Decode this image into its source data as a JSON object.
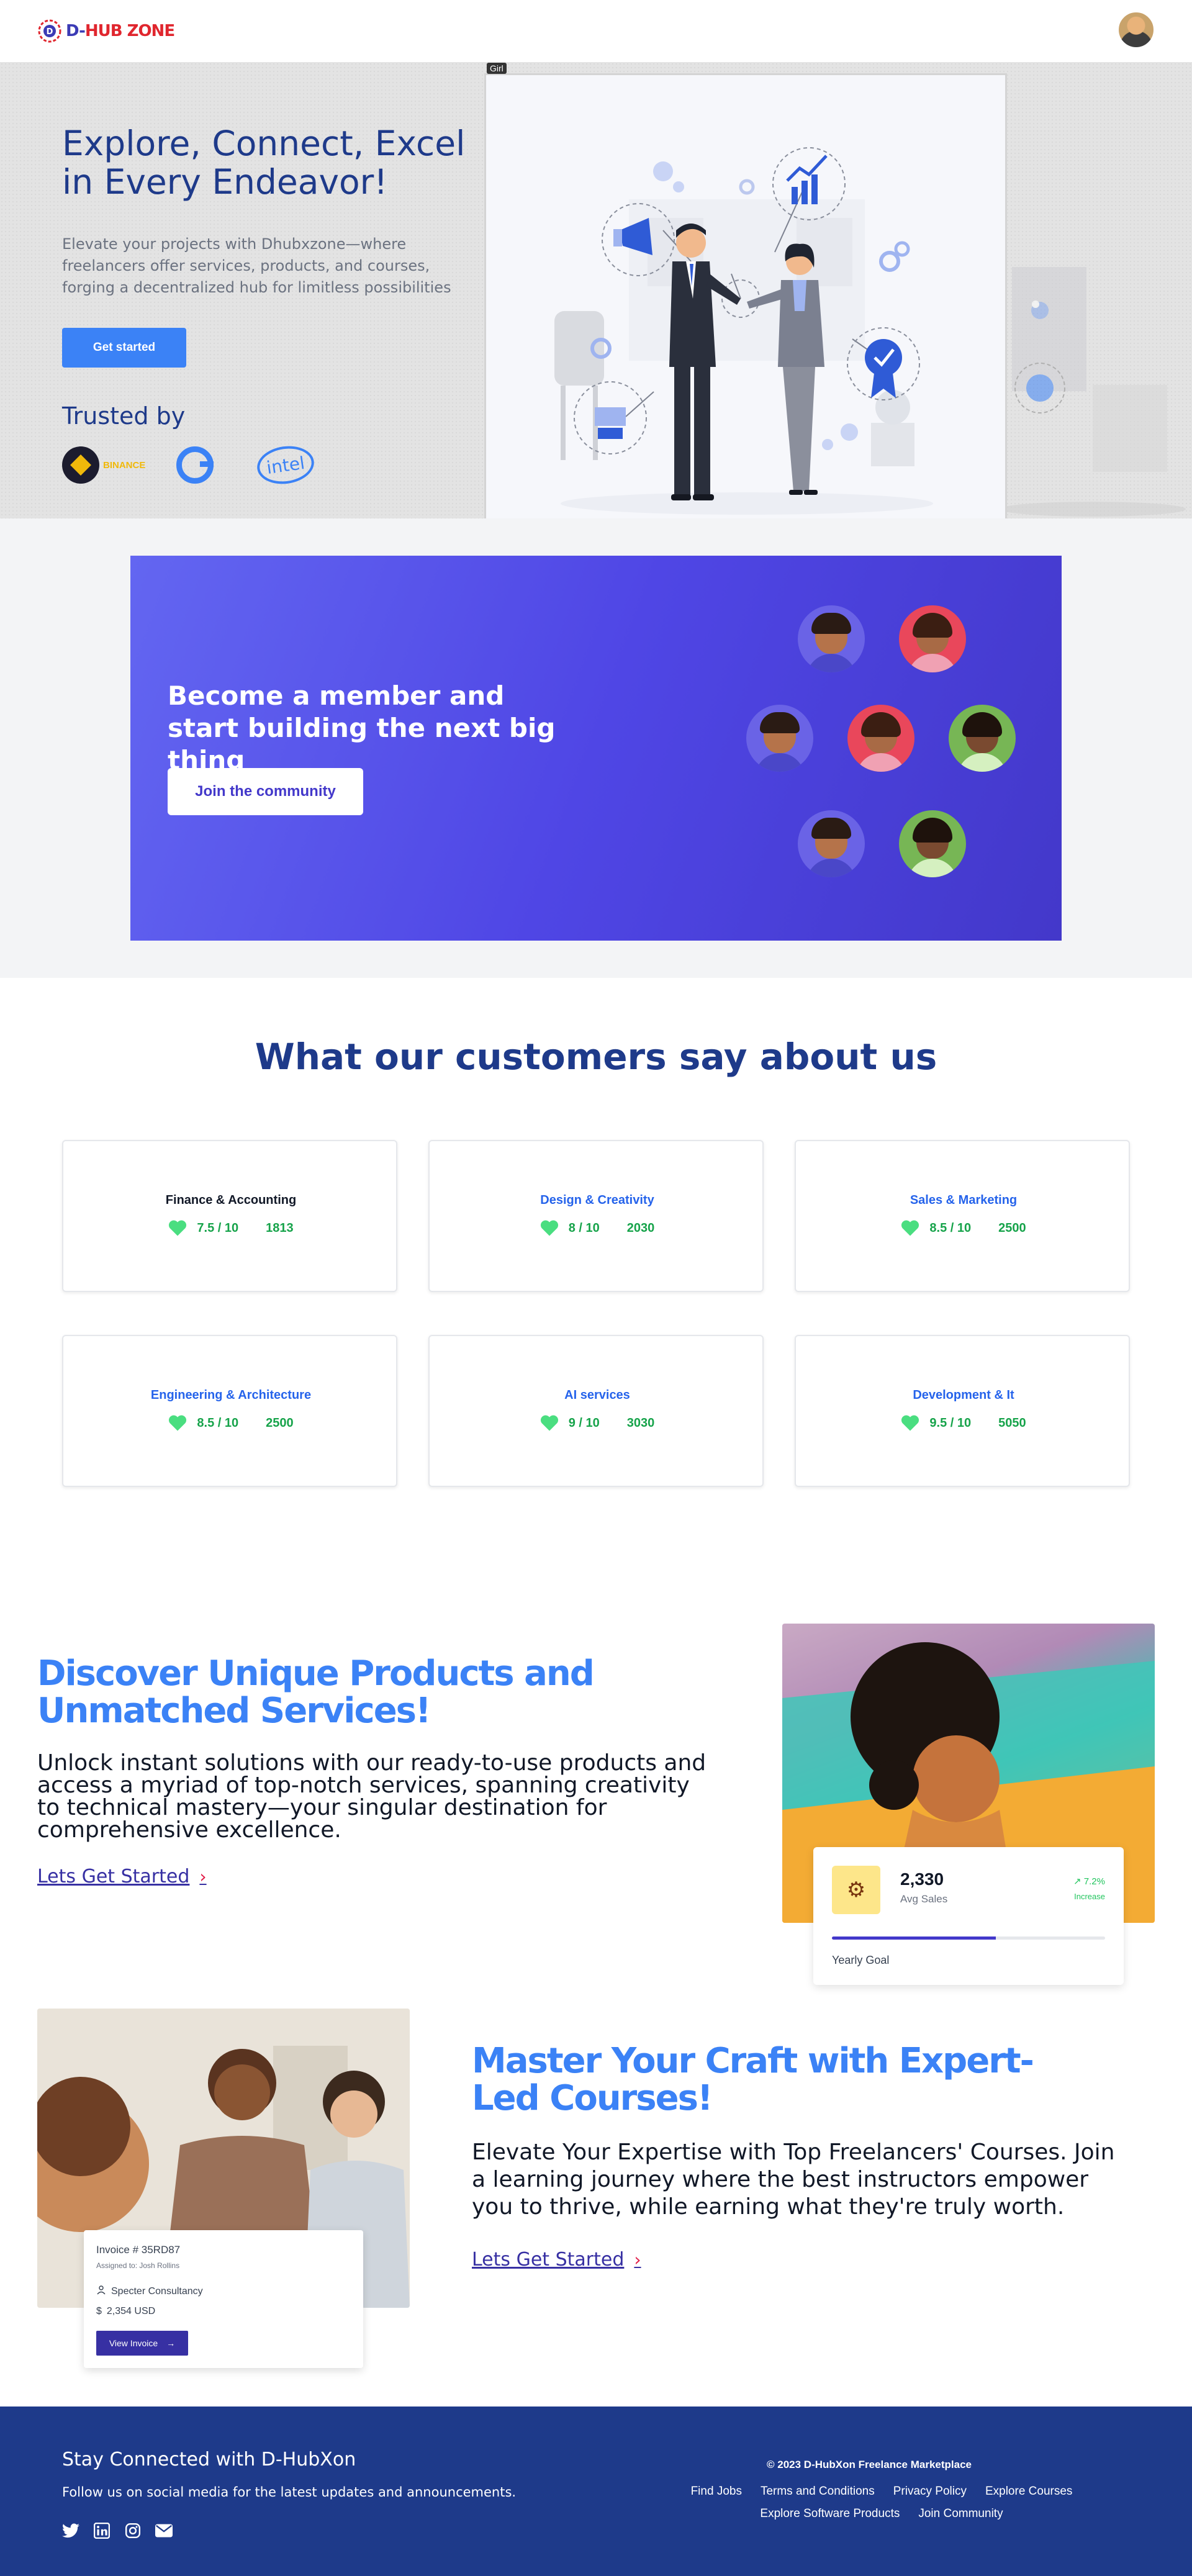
{
  "nav": {
    "logo_text_d": "D-",
    "logo_text_rest": "HUB ZONE",
    "logo_alt": "Logo"
  },
  "hero": {
    "title": "Explore, Connect, Excel in Every Endeavor!",
    "subtitle": "Elevate your projects with Dhubxzone—where freelancers offer services, products, and courses, forging a decentralized hub for limitless possibilities",
    "cta_label": "Get started",
    "trusted_label": "Trusted by",
    "brands": [
      "BINANCE",
      "intel"
    ],
    "illustration_tag": "Girl",
    "brand_color": "#1e3a8a",
    "accent_color": "#3b82f6"
  },
  "member_banner": {
    "title": "Become a member and start building the next big thing",
    "cta_label": "Join the community",
    "gradient": [
      "#6366f1",
      "#4338ca"
    ]
  },
  "reviews": {
    "title": "What our customers say about us",
    "cards": [
      {
        "category": "Finance & Accounting",
        "rating": "7.5 / 10",
        "count": "1813",
        "title_color": "#111827"
      },
      {
        "category": "Design & Creativity",
        "rating": "8 / 10",
        "count": "2030",
        "title_color": "#2563eb"
      },
      {
        "category": "Sales & Marketing",
        "rating": "8.5 / 10",
        "count": "2500",
        "title_color": "#2563eb"
      },
      {
        "category": "Engineering & Architecture",
        "rating": "8.5 / 10",
        "count": "2500",
        "title_color": "#2563eb"
      },
      {
        "category": "AI services",
        "rating": "9 / 10",
        "count": "3030",
        "title_color": "#2563eb"
      },
      {
        "category": "Development & It",
        "rating": "9.5 / 10",
        "count": "5050",
        "title_color": "#2563eb"
      }
    ]
  },
  "discover": {
    "title": "Discover Unique Products and Unmatched Services!",
    "text": "Unlock instant solutions with our ready-to-use products and access a myriad of top-notch services, spanning creativity to technical mastery—your singular destination for comprehensive excellence.",
    "cta_label": "Lets Get Started",
    "stat": {
      "value": "2,330",
      "label": "Avg Sales",
      "percent": "7.2%",
      "trend": "Increase",
      "goal_label": "Yearly Goal",
      "goal_progress": 0.6
    }
  },
  "master": {
    "title": "Master Your Craft with Expert-Led Courses!",
    "text": "Elevate Your Expertise with Top Freelancers' Courses. Join a learning journey where the best instructors empower you to thrive, while earning what they're truly worth.",
    "cta_label": "Lets Get Started",
    "invoice": {
      "number": "Invoice # 35RD87",
      "assigned": "Assigned to: Josh Rollins",
      "company": "Specter Consultancy",
      "amount": "2,354 USD",
      "button": "View Invoice"
    }
  },
  "footer": {
    "title": "Stay Connected with D-HubXon",
    "subtitle": "Follow us on social media for the latest updates and announcements.",
    "copyright": "© 2023 D-HubXon Freelance Marketplace",
    "links": [
      "Find Jobs",
      "Terms and Conditions",
      "Privacy Policy",
      "Explore Courses",
      "Explore Software Products",
      "Join Community"
    ],
    "social_icons": [
      "twitter-icon",
      "linkedin-icon",
      "instagram-icon",
      "mail-icon"
    ]
  }
}
